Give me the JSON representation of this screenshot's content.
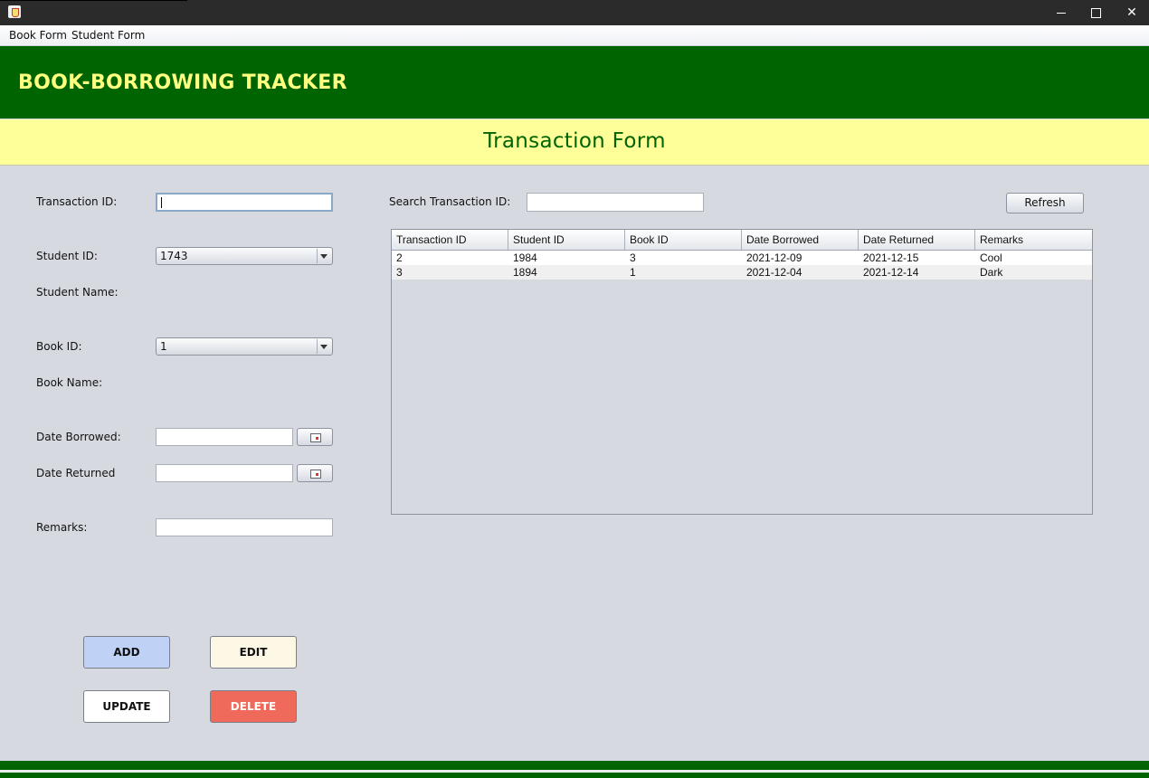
{
  "menubar": {
    "items": [
      "Book Form",
      "Student Form"
    ]
  },
  "header": {
    "app_title": "BOOK-BORROWING TRACKER",
    "form_title": "Transaction Form"
  },
  "form": {
    "transaction_id_label": "Transaction ID:",
    "transaction_id_value": "",
    "student_id_label": "Student ID:",
    "student_id_value": "1743",
    "student_name_label": "Student Name:",
    "book_id_label": "Book ID:",
    "book_id_value": "1",
    "book_name_label": "Book Name:",
    "date_borrowed_label": "Date Borrowed:",
    "date_borrowed_value": "",
    "date_returned_label": "Date Returned",
    "date_returned_value": "",
    "remarks_label": "Remarks:",
    "remarks_value": ""
  },
  "buttons": {
    "add": "ADD",
    "edit": "EDIT",
    "update": "UPDATE",
    "delete": "DELETE"
  },
  "search": {
    "label": "Search Transaction ID:",
    "value": "",
    "refresh": "Refresh"
  },
  "table": {
    "columns": [
      "Transaction ID",
      "Student ID",
      "Book ID",
      "Date Borrowed",
      "Date Returned",
      "Remarks"
    ],
    "rows": [
      [
        "2",
        "1984",
        "3",
        "2021-12-09",
        "2021-12-15",
        "Cool"
      ],
      [
        "3",
        "1894",
        "1",
        "2021-12-04",
        "2021-12-14",
        "Dark"
      ]
    ]
  },
  "colors": {
    "header_green": "#006400",
    "title_yellow": "#ffff80",
    "subheader_yellow": "#ffff99",
    "delete_red": "#ef6a5a",
    "add_blue": "#bfd2f5"
  }
}
